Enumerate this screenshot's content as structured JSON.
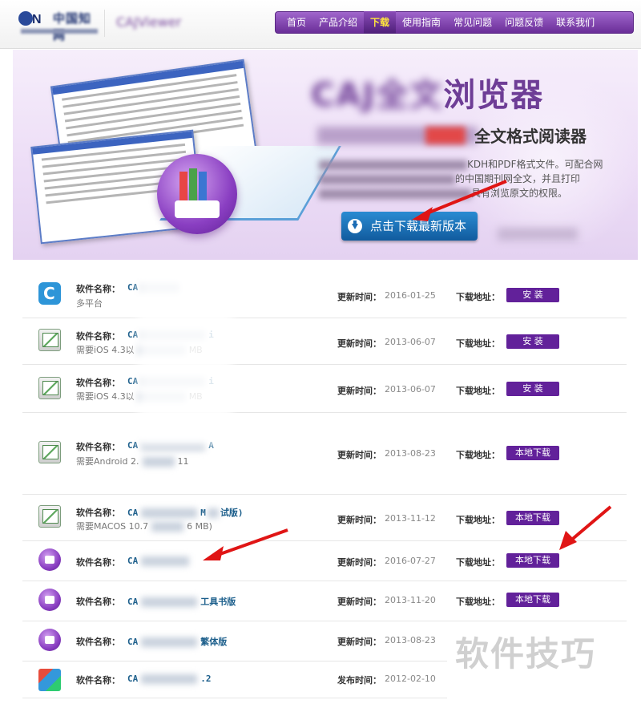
{
  "header": {
    "logo_text": "中国知网",
    "subtitle": "CAJViewer",
    "nav": [
      {
        "label": "首页",
        "active": false
      },
      {
        "label": "产品介绍",
        "active": false
      },
      {
        "label": "下载",
        "active": true
      },
      {
        "label": "使用指南",
        "active": false
      },
      {
        "label": "常见问题",
        "active": false
      },
      {
        "label": "问题反馈",
        "active": false
      },
      {
        "label": "联系我们",
        "active": false
      }
    ]
  },
  "banner": {
    "title_visible": "浏览器",
    "subtitle_visible": "全文格式阅读器",
    "desc_lines": [
      "KDH和PDF格式文件。可配合网",
      "的中国期刊网全文，并且打印",
      "具有浏览原文的权限。"
    ],
    "download_button": "点击下载最新版本"
  },
  "list": {
    "name_label": "软件名称：",
    "update_label": "更新时间：",
    "publish_label": "发布时间：",
    "download_label": "下载地址：",
    "rows": [
      {
        "name": "CA",
        "sub": "多平台",
        "date": "2016-01-25",
        "button": "安 装"
      },
      {
        "name": "CA",
        "name_tail": "i",
        "sub": "需要iOS 4.3以",
        "sub_tail": "MB",
        "date": "2013-06-07",
        "button": "安 装"
      },
      {
        "name": "CA",
        "name_tail": "i",
        "sub": "需要iOS 4.3以",
        "sub_tail": "MB",
        "date": "2013-06-07",
        "button": "安 装"
      },
      {
        "name": "CA",
        "name_tail": "A",
        "sub": "需要Android 2.",
        "sub_tail": "11",
        "date": "2013-08-23",
        "button": "本地下载"
      },
      {
        "name": "CA",
        "name_tail": "M",
        "name_tail2": "试版)",
        "sub": "需要MACOS 10.7",
        "sub_tail": "6 MB)",
        "date": "2013-11-12",
        "button": "本地下载"
      },
      {
        "name": "CA",
        "date": "2016-07-27",
        "button": "本地下载"
      },
      {
        "name": "CA",
        "name_tail": "工具书版",
        "date": "2013-11-20",
        "button": "本地下载"
      },
      {
        "name": "CA",
        "name_tail": "繁体版",
        "date": "2013-08-23"
      },
      {
        "name": "CA",
        "name_tail": ".2",
        "date": "2012-02-10",
        "publish": true
      }
    ]
  },
  "watermark": "软件技巧",
  "colors": {
    "nav_purple": "#6a2e98",
    "button_purple": "#62219a",
    "download_blue": "#1b6db5",
    "arrow_red": "#e01515"
  }
}
